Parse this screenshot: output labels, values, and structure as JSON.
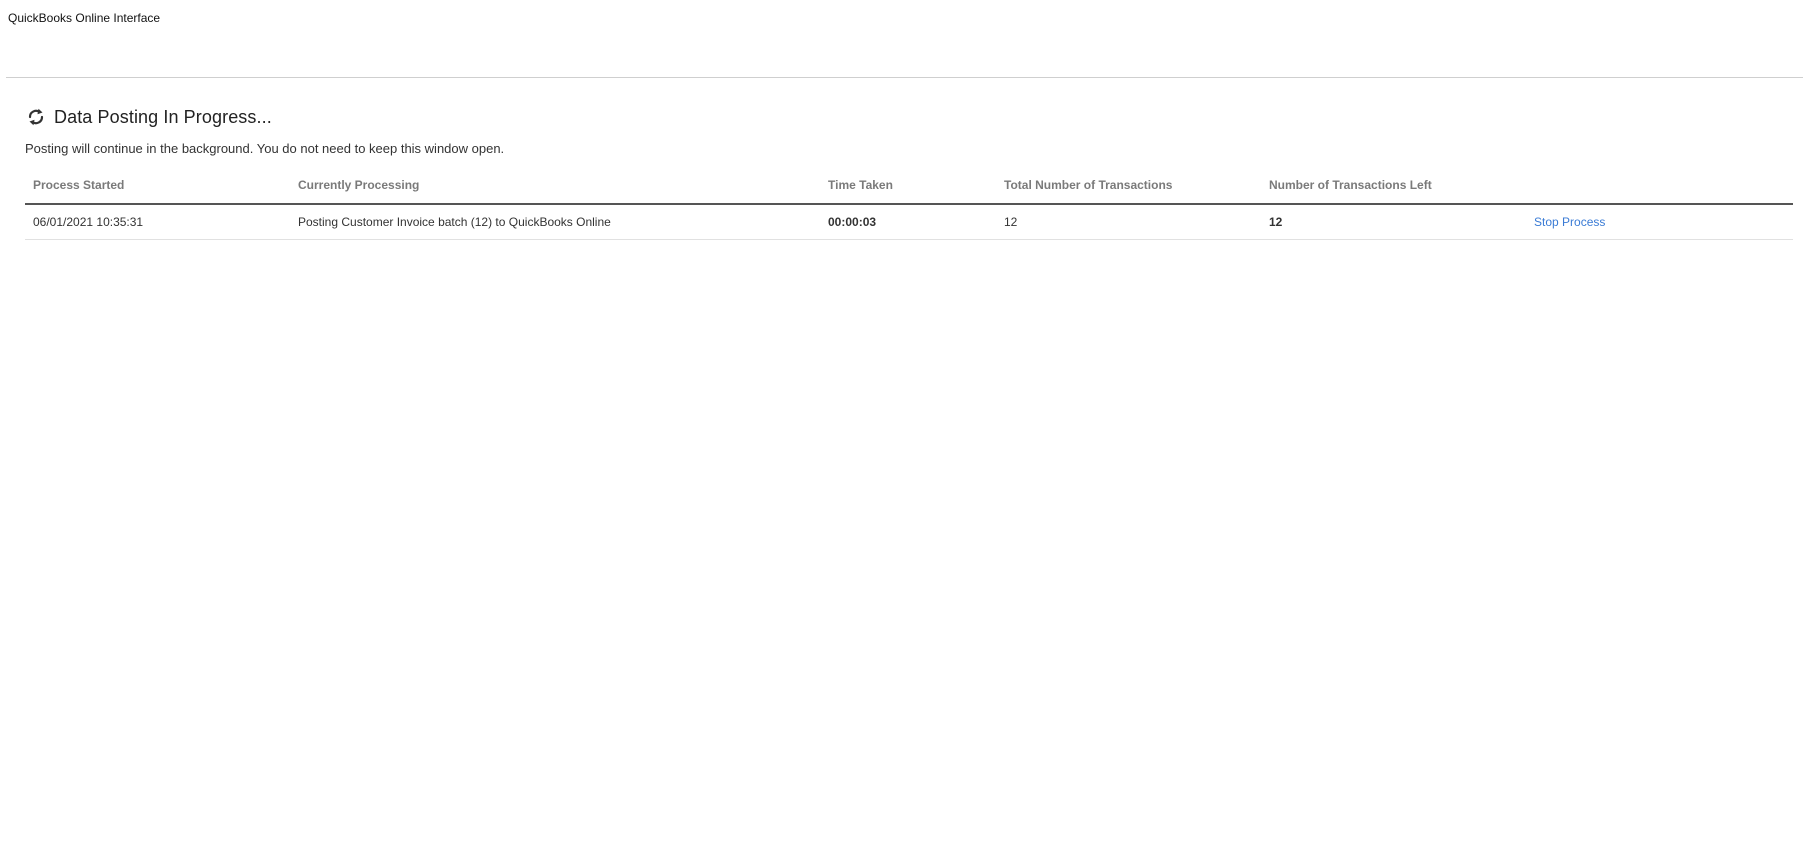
{
  "app": {
    "title": "QuickBooks Online Interface"
  },
  "status": {
    "icon": "refresh-icon",
    "heading": "Data Posting In Progress...",
    "message": "Posting will continue in the background. You do not need to keep this window open."
  },
  "table": {
    "headers": {
      "process_started": "Process Started",
      "currently_processing": "Currently Processing",
      "time_taken": "Time Taken",
      "total_transactions": "Total Number of Transactions",
      "transactions_left": "Number of Transactions Left"
    },
    "rows": [
      {
        "process_started": "06/01/2021 10:35:31",
        "currently_processing": "Posting Customer Invoice batch (12) to QuickBooks Online",
        "time_taken": "00:00:03",
        "total_transactions": "12",
        "transactions_left": "12",
        "action_label": "Stop Process"
      }
    ]
  },
  "colors": {
    "link": "#3a7bd5",
    "header_text": "#7a7a7a"
  }
}
